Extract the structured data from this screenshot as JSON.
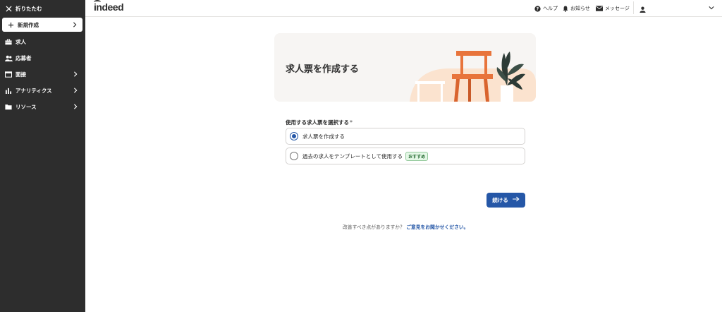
{
  "sidebar": {
    "collapse_label": "折りたたむ",
    "items": [
      {
        "label": "新規作成",
        "icon": "plus-icon",
        "chevron": true
      },
      {
        "label": "求人",
        "icon": "briefcase-icon",
        "chevron": false
      },
      {
        "label": "応募者",
        "icon": "people-icon",
        "chevron": false
      },
      {
        "label": "面接",
        "icon": "calendar-icon",
        "chevron": true
      },
      {
        "label": "アナリティクス",
        "icon": "bar-chart-icon",
        "chevron": true
      },
      {
        "label": "リソース",
        "icon": "folder-icon",
        "chevron": true
      }
    ]
  },
  "header": {
    "logo": "indeed",
    "help": "ヘルプ",
    "notifications": "お知らせ",
    "messages": "メッセージ"
  },
  "hero": {
    "title": "求人票を作成する"
  },
  "form": {
    "question": "使用する求人票を選択する",
    "required_mark": "*",
    "options": [
      {
        "label": "求人票を作成する",
        "selected": true
      },
      {
        "label": "過去の求人をテンプレートとして使用する",
        "selected": false,
        "badge": "おすすめ"
      }
    ],
    "continue_label": "続ける"
  },
  "feedback": {
    "prompt": "改善すべき点がありますか？",
    "link": "ご意見をお聞かせください。"
  },
  "colors": {
    "sidebar_bg": "#2d2d2d",
    "primary": "#2557a7",
    "hero_bg": "#f7f5f3",
    "chair": "#e8743b"
  }
}
